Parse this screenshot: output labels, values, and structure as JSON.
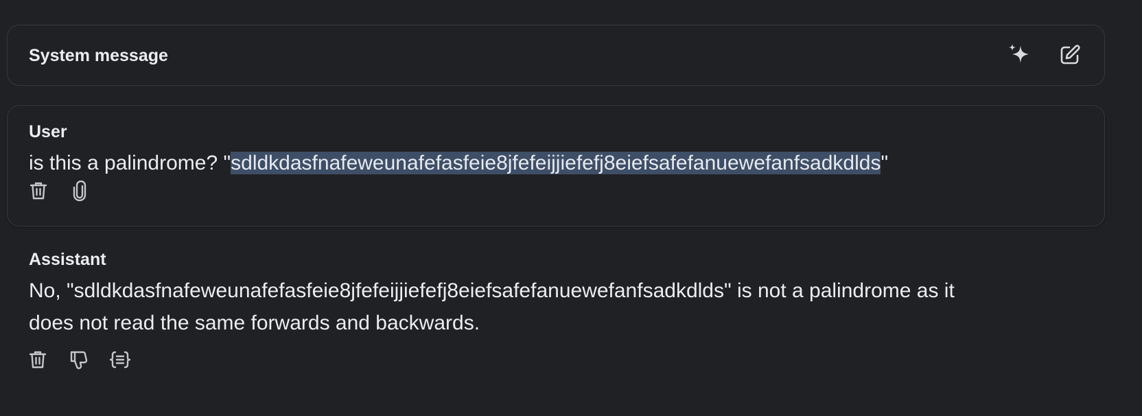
{
  "system": {
    "title": "System message",
    "sparkle_icon": "sparkle-icon",
    "edit_icon": "edit-icon"
  },
  "user": {
    "role": "User",
    "message_prefix": "is this a palindrome? \"",
    "message_highlight": "sdldkdasfnafeweunafefasfeie8jfefeijjiefefj8eiefsafefanuewefanfsadkdlds",
    "message_suffix": "\"",
    "actions": [
      "trash-icon",
      "paperclip-icon"
    ]
  },
  "assistant": {
    "role": "Assistant",
    "message_line1": "No, \"sdldkdasfnafeweunafefasfeie8jfefeijjiefefj8eiefsafefanuewefanfsadkdlds\" is not a palindrome as it",
    "message_line2": "does not read the same forwards and backwards.",
    "actions": [
      "trash-icon",
      "thumbs-down-icon",
      "code-braces-icon"
    ]
  },
  "colors": {
    "background": "#202124",
    "border": "#36383d",
    "text": "#ececf1",
    "selection": "#3e4e66",
    "icon": "#c5c6cc"
  }
}
